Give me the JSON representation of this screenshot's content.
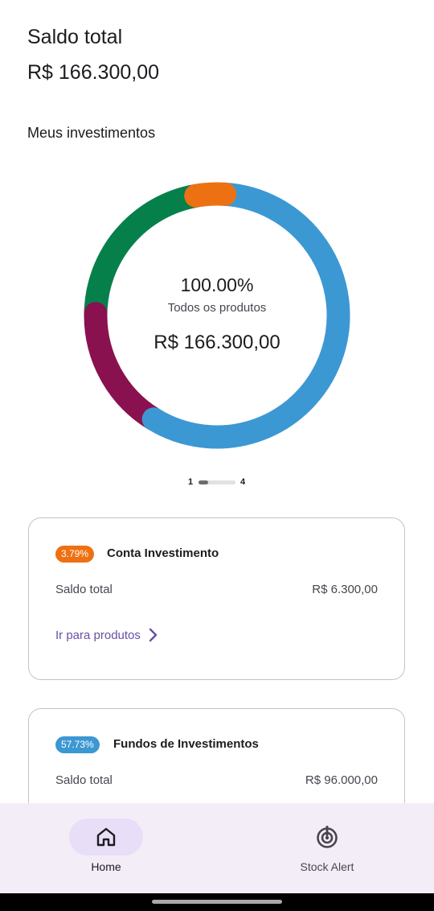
{
  "header": {
    "balance_label": "Saldo total",
    "balance_value": "R$ 166.300,00"
  },
  "section_title": "Meus investimentos",
  "chart_data": {
    "type": "donut",
    "center": {
      "percent": "100.00%",
      "caption": "Todos os produtos",
      "total": "R$ 166.300,00"
    },
    "slices": [
      {
        "label": "Conta Investimento",
        "value": 3.79,
        "color": "#ed7112"
      },
      {
        "label": "Fundos de Investimentos",
        "value": 57.73,
        "color": "#3c98d3"
      },
      {
        "value": 16.5,
        "color": "#8a1150"
      },
      {
        "value": 21.98,
        "color": "#06804b"
      }
    ]
  },
  "pager": {
    "start": "1",
    "end": "4",
    "progress": 0.25
  },
  "cards": [
    {
      "badge": "3.79%",
      "badge_color": "#ed7112",
      "title": "Conta Investimento",
      "balance_label": "Saldo total",
      "balance_value": "R$ 6.300,00",
      "link_label": "Ir para produtos"
    },
    {
      "badge": "57.73%",
      "badge_color": "#3c98d3",
      "title": "Fundos de Investimentos",
      "balance_label": "Saldo total",
      "balance_value": "R$ 96.000,00"
    }
  ],
  "bottom_nav": {
    "items": [
      {
        "label": "Home",
        "icon": "home-icon",
        "selected": true
      },
      {
        "label": "Stock Alert",
        "icon": "stock-alert-icon",
        "selected": false
      }
    ]
  },
  "colors": {
    "accent": "#6750a4",
    "nav_background": "#f3edf7",
    "nav_indicator": "#e8def8"
  }
}
